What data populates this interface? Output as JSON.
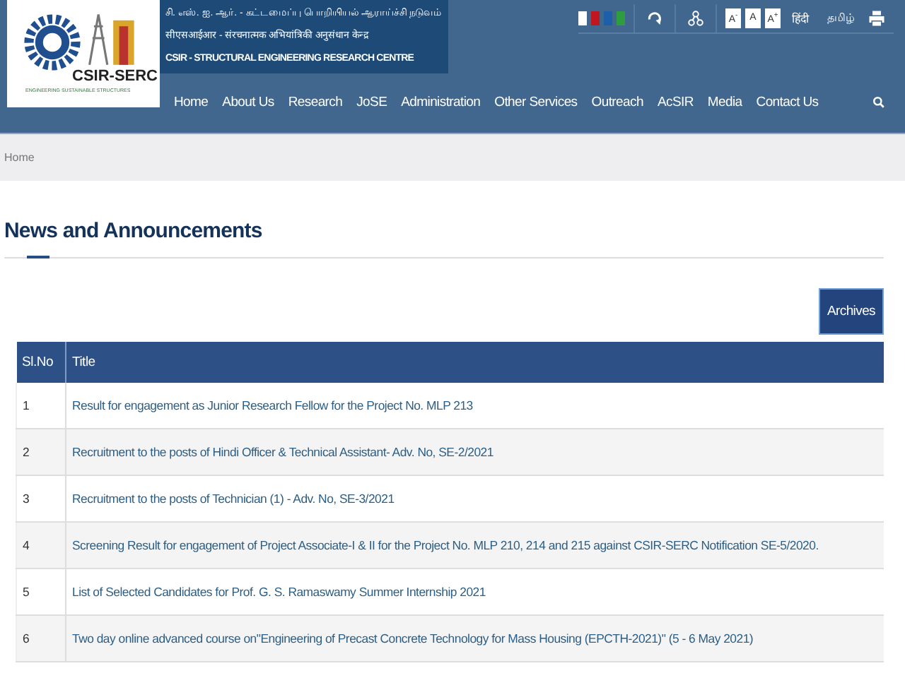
{
  "logo": {
    "name": "CSIR-SERC",
    "tagline": "ENGINEERING SUSTAINABLE STRUCTURES"
  },
  "org_names": [
    "சி. எஸ். ஐ. ஆர். - கட்டமைப்பு பொறியியல் ஆராய்ச்சி நடுவம்",
    "सीएसआईआर - संरचनात्मक अभियांत्रिकी अनुसंधान केन्द्र",
    "CSIR - STRUCTURAL ENGINEERING RESEARCH CENTRE"
  ],
  "theme_swatches": [
    {
      "color": "#ffffff"
    },
    {
      "color": "#c0161e"
    },
    {
      "color": "#1d5fa8"
    },
    {
      "color": "#2e9c3f"
    }
  ],
  "font_size_buttons": [
    "A$^{-}$",
    "A",
    "A$^{+}$"
  ],
  "languages": [
    "हिंदी",
    "தமிழ்"
  ],
  "nav": [
    "Home",
    "About Us",
    "Research",
    "JoSE",
    "Administration",
    "Other Services",
    "Outreach",
    "AcSIR",
    "Media",
    "Contact Us"
  ],
  "breadcrumb": "Home",
  "heading": "News and Announcements",
  "archives_button": "Archives",
  "table": {
    "columns": [
      "Sl.No",
      "Title"
    ],
    "rows": [
      [
        "1",
        "Result for engagement as Junior Research Fellow for the Project No. MLP 213"
      ],
      [
        "2",
        "Recruitment to the posts of Hindi Officer & Technical Assistant- Adv. No, SE-2/2021"
      ],
      [
        "3",
        "Recruitment to the posts of Technician (1) - Adv. No, SE-3/2021"
      ],
      [
        "4",
        "Screening Result for engagement of Project Associate-I & II for the Project No. MLP 210, 214 and 215 against CSIR-SERC Notification SE-5/2020."
      ],
      [
        "5",
        "List of Selected Candidates for Prof. G. S. Ramaswamy Summer Internship 2021"
      ],
      [
        "6",
        "Two day online advanced course on\"Engineering of Precast Concrete Technology for Mass Housing (EPCTH-2021)\" (5 - 6 May 2021)"
      ]
    ]
  }
}
